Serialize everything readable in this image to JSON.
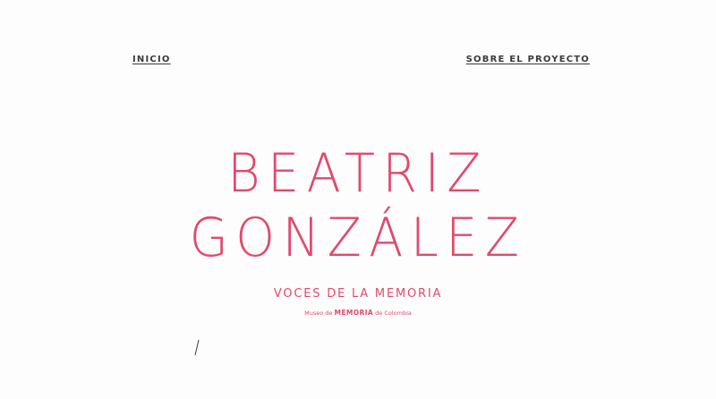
{
  "nav": {
    "left_label": "INICIO",
    "right_label": "SOBRE EL PROYECTO"
  },
  "hero": {
    "title_line_1": "BEATRIZ",
    "title_line_2": "GONZÁLEZ",
    "subtitle": "VOCES DE LA MEMORIA",
    "credit_prefix": "Museo de",
    "credit_strong": "MEMORIA",
    "credit_suffix": "de Colombia"
  },
  "colors": {
    "accent": "#e2496e",
    "nav_text": "#3a3a3a",
    "background": "#fdfdfd"
  }
}
